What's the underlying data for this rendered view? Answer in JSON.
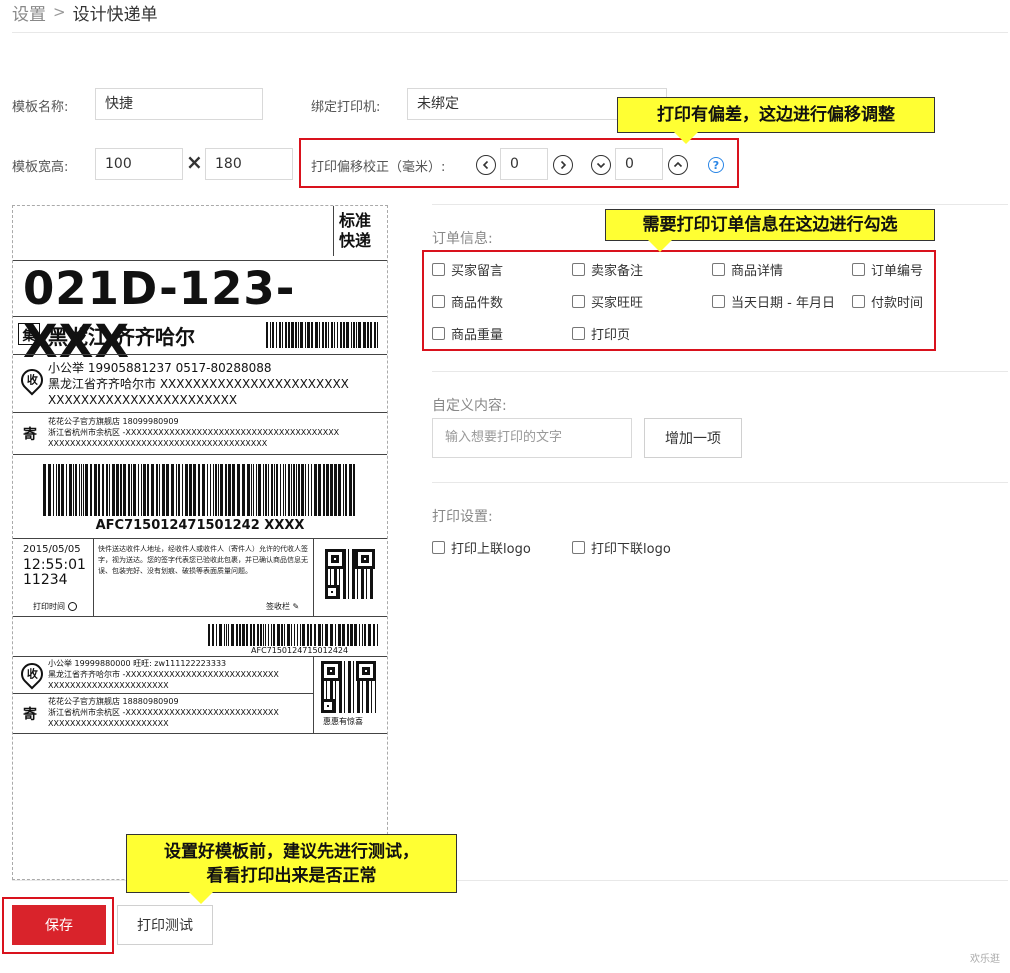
{
  "breadcrumb": {
    "parent": "设置",
    "separator": ">",
    "current": "设计快递单"
  },
  "template": {
    "name_label": "模板名称:",
    "name_value": "快捷",
    "printer_label": "绑定打印机:",
    "printer_value": "未绑定",
    "size_label": "模板宽高:",
    "width_value": "100",
    "times": "×",
    "height_value": "180",
    "offset_label": "打印偏移校正（毫米）:",
    "offset_x_value": "0",
    "offset_y_value": "0",
    "help": "?"
  },
  "callouts": {
    "offset": "打印有偏差，这边进行偏移调整",
    "order_info": "需要打印订单信息在这边进行勾选",
    "test_line1": "设置好模板前，建议先进行测试，",
    "test_line2": "看看打印出来是否正常"
  },
  "order_info": {
    "title": "订单信息:",
    "items": [
      {
        "label": "买家留言",
        "checked": false
      },
      {
        "label": "卖家备注",
        "checked": false
      },
      {
        "label": "商品详情",
        "checked": false
      },
      {
        "label": "订单编号",
        "checked": false
      },
      {
        "label": "商品件数",
        "checked": false
      },
      {
        "label": "买家旺旺",
        "checked": false
      },
      {
        "label": "当天日期 - 年月日",
        "checked": false
      },
      {
        "label": "付款时间",
        "checked": false
      },
      {
        "label": "商品重量",
        "checked": false
      },
      {
        "label": "打印页",
        "checked": false
      }
    ]
  },
  "custom": {
    "title": "自定义内容:",
    "placeholder": "输入想要打印的文字",
    "add_button": "增加一项"
  },
  "print_settings": {
    "title": "打印设置:",
    "items": [
      {
        "label": "打印上联logo",
        "checked": false
      },
      {
        "label": "打印下联logo",
        "checked": false
      }
    ]
  },
  "buttons": {
    "save": "保存",
    "test_print": "打印测试"
  },
  "label": {
    "badge_line1": "标准",
    "badge_line2": "快递",
    "code": "021D-123-XXX",
    "ji": "集",
    "destination": "黑龙江 齐齐哈尔",
    "recv_icon": "收",
    "recv_line1": "小公举   19905881237   0517-80288088",
    "recv_line2": "黑龙江省齐齐哈尔市 XXXXXXXXXXXXXXXXXXXXXXX",
    "recv_line3": "XXXXXXXXXXXXXXXXXXXXXXX",
    "send_icon": "寄",
    "send_line1": "花花公子官方旗舰店   18099980909",
    "send_line2": "浙江省杭州市余杭区 -XXXXXXXXXXXXXXXXXXXXXXXXXXXXXXXXXXXXXXX",
    "send_line3": "XXXXXXXXXXXXXXXXXXXXXXXXXXXXXXXXXXXXXXXX",
    "main_barcode_text": "AFC715012471501242 XXXX",
    "date": "2015/05/05",
    "time": "12:55:01",
    "num": "11234",
    "notice": "快件送达收件人地址，经收件人或收件人（寄件人）允许的代收人签字，视为送达。您的签字代表您已验收此包裹，并已确认商品信息无误、包装完好、没有划痕、破损等表面质量问题。",
    "print_time": "打印时间",
    "sign": "签收栏",
    "small_barcode_text": "AFC7150124715012424",
    "recv2_line1": "小公举   19999880000   旺旺: zw111122223333",
    "recv2_line2": "黑龙江省齐齐哈尔市 -XXXXXXXXXXXXXXXXXXXXXXXXXXXX",
    "recv2_line3": "XXXXXXXXXXXXXXXXXXXXXX",
    "send2_line1": "花花公子官方旗舰店   18880980909",
    "send2_line2": "浙江省杭州市余杭区 -XXXXXXXXXXXXXXXXXXXXXXXXXXXX",
    "send2_line3": "XXXXXXXXXXXXXXXXXXXXXX",
    "qr_caption": "惠惠有惊喜"
  },
  "watermark": "欢乐逛"
}
